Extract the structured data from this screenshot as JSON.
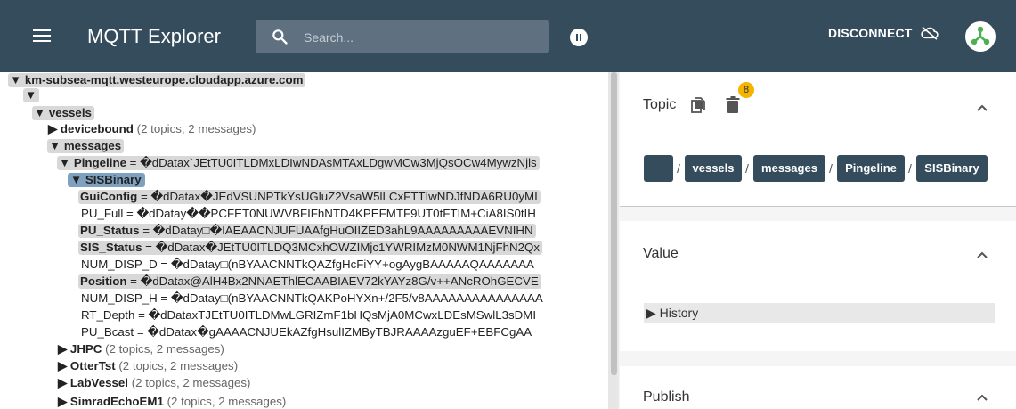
{
  "appbar": {
    "title": "MQTT Explorer",
    "search_placeholder": "Search...",
    "disconnect_label": "DISCONNECT",
    "icons": [
      "menu-icon",
      "search-icon",
      "pause-icon",
      "cloud-off-icon",
      "user-avatar-icon"
    ],
    "colors": {
      "bar": "#354c5d",
      "avatar_icon": "#4caf50"
    }
  },
  "tree": {
    "root": "▼ km-subsea-mqtt.westeurope.cloudapp.azure.com",
    "empty_node": "▼",
    "vessels": "▼ vessels",
    "devicebound": {
      "name": "▶ devicebound",
      "meta": "(2 topics, 2 messages)"
    },
    "messages": "▼ messages",
    "pingeline": {
      "name": "▼ Pingeline",
      "value": " = �dDatax`JEtTU0ITLDMxLDIwNDAsMTAxLDgwMCw3MjQsOCw4MywzNjls"
    },
    "sisbinary": "▼ SISBinary",
    "leaves": [
      {
        "name": "GuiConfig",
        "value": " = �dDatax�JEdVSUNPTkYsUGluZ2VsaW5lLCxFTTIwNDJfNDA6RU0yMI"
      },
      {
        "name": "PU_Full",
        "value": " = �dDatay��PCFET0NUWVBFIFhNTD4KPEFMTF9UT0tFTIM+CiA8IS0tIH"
      },
      {
        "name": "PU_Status",
        "value": " = �dDatay□�IAEAACNJUFUAAfgHuOIIZED3ahL9AAAAAAAAAEVNIHN"
      },
      {
        "name": "SIS_Status",
        "value": " = �dDatax�JEtTU0ITLDQ3MCxhOWZIMjc1YWRIMzM0NWM1NjFhN2Qx"
      },
      {
        "name": "NUM_DISP_D",
        "value": " = �dDatay□(nBYAACNNTkQAZfgHcFiYY+ogAygBAAAAAQAAAAAAA"
      },
      {
        "name": "Position",
        "value": " = �dDatax@AlH4Bx2NNAEThlECAABIAEV72kYAYz8G/v++ANcROhGECVE"
      },
      {
        "name": "NUM_DISP_H",
        "value": " = �dDatay□(nBYAACNNTkQAKPoHYXn+/2F5/v8AAAAAAAAAAAAAAA"
      },
      {
        "name": "RT_Depth",
        "value": " = �dDataxTJEtTU0ITLDMwLGRIZmF1bHQsMjA0MCwxLDEsMSwlL3sDMI"
      },
      {
        "name": "PU_Bcast",
        "value": " = �dDatax�gAAAACNJUEkAZfgHsulIZMByTBJRAAAAzguEF+EBFCgAA"
      }
    ],
    "collapsed": [
      {
        "name": "▶ JHPC",
        "meta": "(2 topics, 2 messages)"
      },
      {
        "name": "▶ OtterTst",
        "meta": "(2 topics, 2 messages)"
      },
      {
        "name": "▶ LabVessel",
        "meta": "(2 topics, 2 messages)"
      },
      {
        "name": "▶ SimradEchoEM1",
        "meta": "(2 topics, 2 messages)"
      }
    ]
  },
  "topic_panel": {
    "title": "Topic",
    "badge": "8",
    "breadcrumb": [
      "",
      "vessels",
      "messages",
      "Pingeline",
      "SISBinary"
    ],
    "separator": "/"
  },
  "value_panel": {
    "title": "Value",
    "history_label": "▶ History"
  },
  "publish_panel": {
    "title": "Publish"
  }
}
